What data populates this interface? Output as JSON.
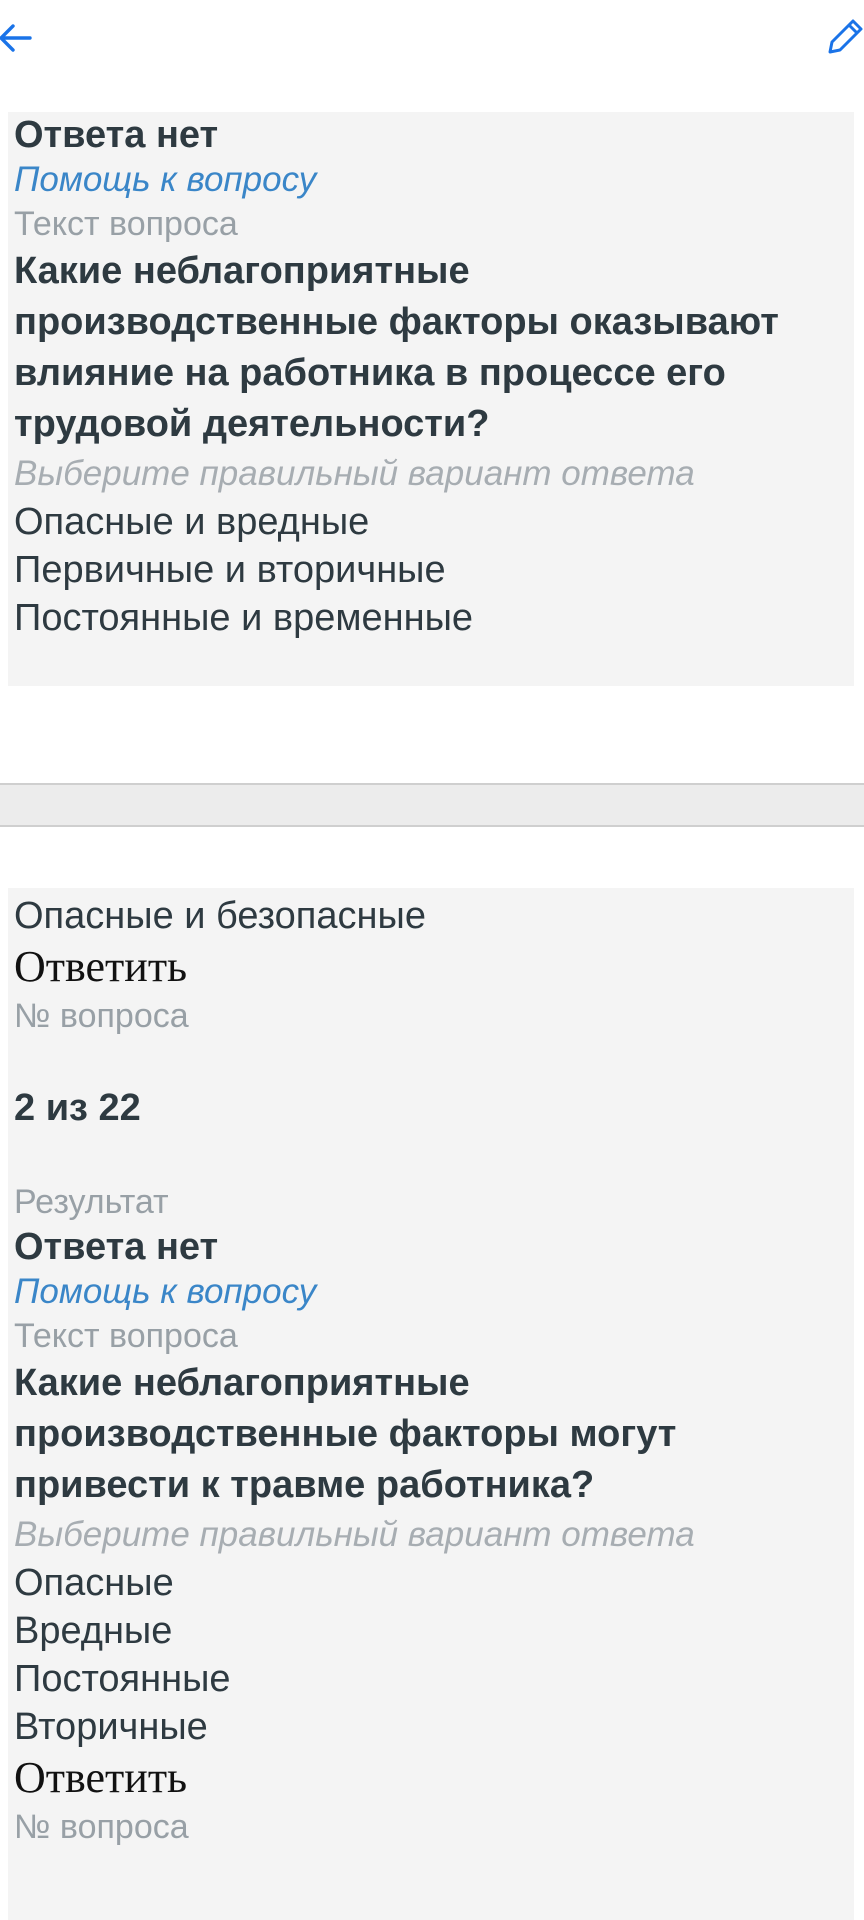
{
  "toolbar": {
    "back_icon": "arrow-left-icon",
    "edit_icon": "pencil-icon",
    "accent_color": "#1a73e8"
  },
  "card1": {
    "status": "Ответа нет",
    "help_link": "Помощь к вопросу",
    "question_label": "Текст вопроса",
    "question": "Какие неблагоприятные производственные факторы оказывают влияние на работника в процессе его трудовой деятельности?",
    "hint": "Выберите правильный вариант ответа",
    "options": [
      "Опасные и вредные",
      "Первичные и вторичные",
      "Постоянные и временные"
    ]
  },
  "card2": {
    "options_continued": [
      "Опасные и безопасные"
    ],
    "answer_button": "Ответить",
    "number_label": "№ вопроса",
    "number_value": "2 из 22",
    "result_label": "Результат",
    "status": "Ответа нет",
    "help_link": "Помощь к вопросу",
    "question_label": "Текст вопроса",
    "question": "Какие неблагоприятные производственные факторы могут привести к травме работника?",
    "hint": "Выберите правильный вариант ответа",
    "options": [
      "Опасные",
      "Вредные",
      "Постоянные",
      "Вторичные"
    ],
    "answer_button_2": "Ответить",
    "number_label_2": "№ вопроса"
  }
}
